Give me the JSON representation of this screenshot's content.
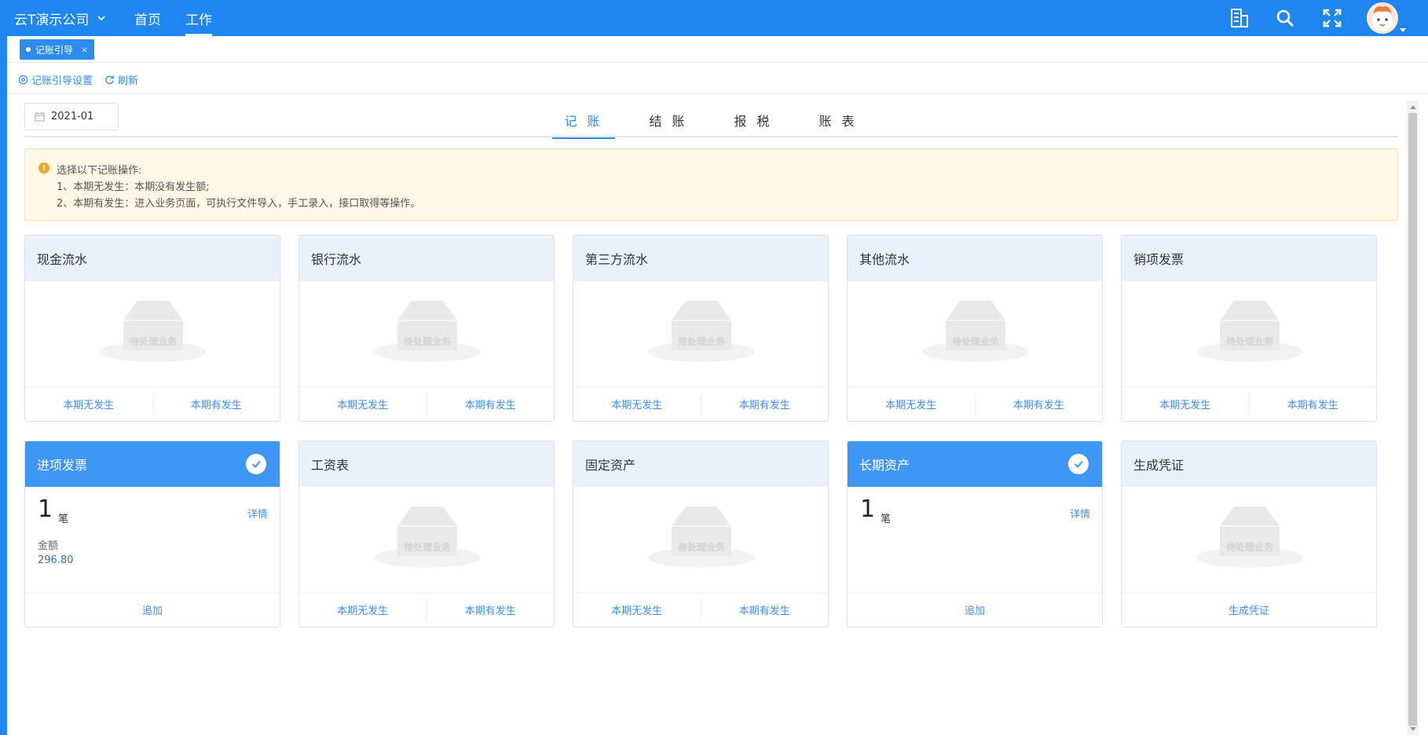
{
  "topbar": {
    "company": "云T演示公司",
    "nav": [
      "首页",
      "工作"
    ],
    "active_nav": "工作",
    "icons": [
      "building-icon",
      "search-icon",
      "fullscreen-icon"
    ]
  },
  "page_tab": {
    "label": "记账引导",
    "close": "×"
  },
  "actions": {
    "settings": "记账引导设置",
    "refresh": "刷新"
  },
  "period": {
    "value": "2021-01"
  },
  "steps": {
    "items": [
      "记 账",
      "结 账",
      "报 税",
      "账 表"
    ],
    "active": "记 账"
  },
  "notice": {
    "line1": "选择以下记账操作:",
    "line2": "1、本期无发生：本期没有发生额;",
    "line3": "2、本期有发生：进入业务页面，可执行文件导入，手工录入，接口取得等操作。"
  },
  "empty_label": "待处理业务",
  "btn": {
    "none": "本期无发生",
    "has": "本期有发生",
    "add": "追加",
    "generate": "生成凭证",
    "detail": "详情"
  },
  "cards": [
    {
      "title": "现金流水",
      "state": "empty"
    },
    {
      "title": "银行流水",
      "state": "empty"
    },
    {
      "title": "第三方流水",
      "state": "empty"
    },
    {
      "title": "其他流水",
      "state": "empty"
    },
    {
      "title": "销项发票",
      "state": "empty"
    },
    {
      "title": "进项发票",
      "state": "done",
      "count": "1",
      "unit": "笔",
      "amount_label": "金额",
      "amount": "296.80"
    },
    {
      "title": "工资表",
      "state": "empty"
    },
    {
      "title": "固定资产",
      "state": "empty"
    },
    {
      "title": "长期资产",
      "state": "done",
      "count": "1",
      "unit": "笔"
    },
    {
      "title": "生成凭证",
      "state": "generate"
    }
  ],
  "colors": {
    "primary": "#1f86f0",
    "accent": "#3d97f5",
    "card_head": "#eaf1fb",
    "notice_bg": "#fff8e7",
    "warn": "#f5a623"
  }
}
